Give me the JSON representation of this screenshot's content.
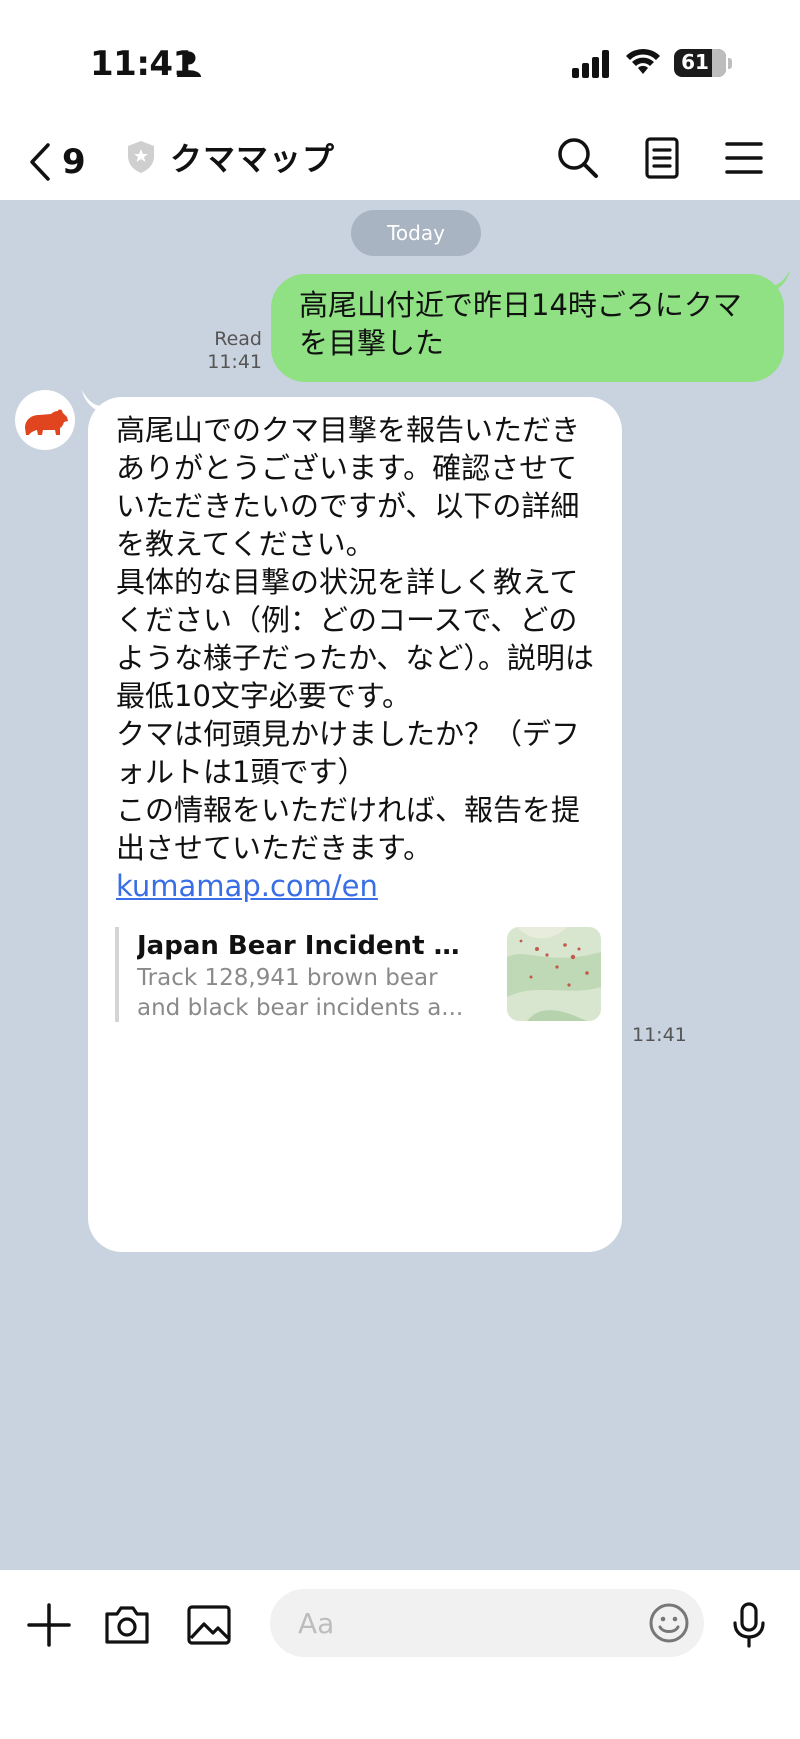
{
  "status_bar": {
    "time": "11:41",
    "battery": "61",
    "battery_level": 0.61
  },
  "header": {
    "back_count": "9",
    "title": "クママップ"
  },
  "chat": {
    "date_divider": "Today",
    "outgoing": {
      "text": "高尾山付近で昨日14時ごろにクマを目撃した",
      "read_label": "Read",
      "time": "11:41"
    },
    "incoming": {
      "text": "高尾山でのクマ目撃を報告いただきありがとうございます。確認させていただきたいのですが、以下の詳細を教えてください。\n具体的な目撃の状況を詳しく教えてください（例：どのコースで、どのような様子だったか、など）。説明は最低10文字必要です。\nクマは何頭見かけましたか？（デフォルトは1頭です）\nこの情報をいただければ、報告を提出させていただきます。",
      "link": "kumamap.com/en",
      "preview": {
        "title": "Japan Bear Incident M...",
        "desc_line1": "Track 128,941 brown bear",
        "desc_line2": "and black bear incidents a..."
      },
      "time": "11:41"
    }
  },
  "input_bar": {
    "placeholder": "Aa"
  },
  "colors": {
    "chat_background": "#c9d3df",
    "outgoing_bubble": "#8fe184",
    "link": "#3a6ee6",
    "bear_avatar": "#e0451f"
  }
}
